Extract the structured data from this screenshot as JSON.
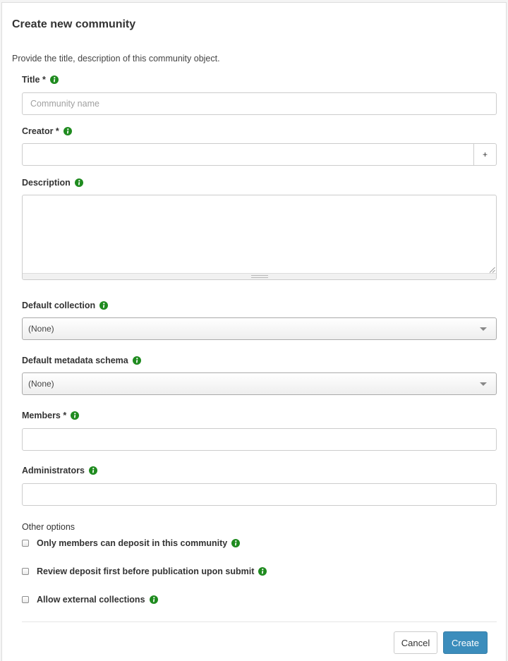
{
  "form": {
    "title": "Create new community",
    "intro": "Provide the title, description of this community object."
  },
  "fields": {
    "title": {
      "label": "Title *",
      "placeholder": "Community name",
      "value": ""
    },
    "creator": {
      "label": "Creator *",
      "value": "",
      "add_label": "+"
    },
    "description": {
      "label": "Description",
      "value": ""
    },
    "default_collection": {
      "label": "Default collection",
      "selected": "(None)"
    },
    "default_metadata_schema": {
      "label": "Default metadata schema",
      "selected": "(None)"
    },
    "members": {
      "label": "Members *",
      "value": ""
    },
    "administrators": {
      "label": "Administrators",
      "value": ""
    }
  },
  "options": {
    "heading": "Other options",
    "items": [
      {
        "label": "Only members can deposit in this community",
        "checked": false
      },
      {
        "label": "Review deposit first before publication upon submit",
        "checked": false
      },
      {
        "label": "Allow external collections",
        "checked": false
      }
    ]
  },
  "actions": {
    "cancel_label": "Cancel",
    "create_label": "Create"
  },
  "icons": {
    "help": "info-icon"
  },
  "colors": {
    "info_icon": "#1f8b1f",
    "primary_button": "#3c8dbc"
  }
}
